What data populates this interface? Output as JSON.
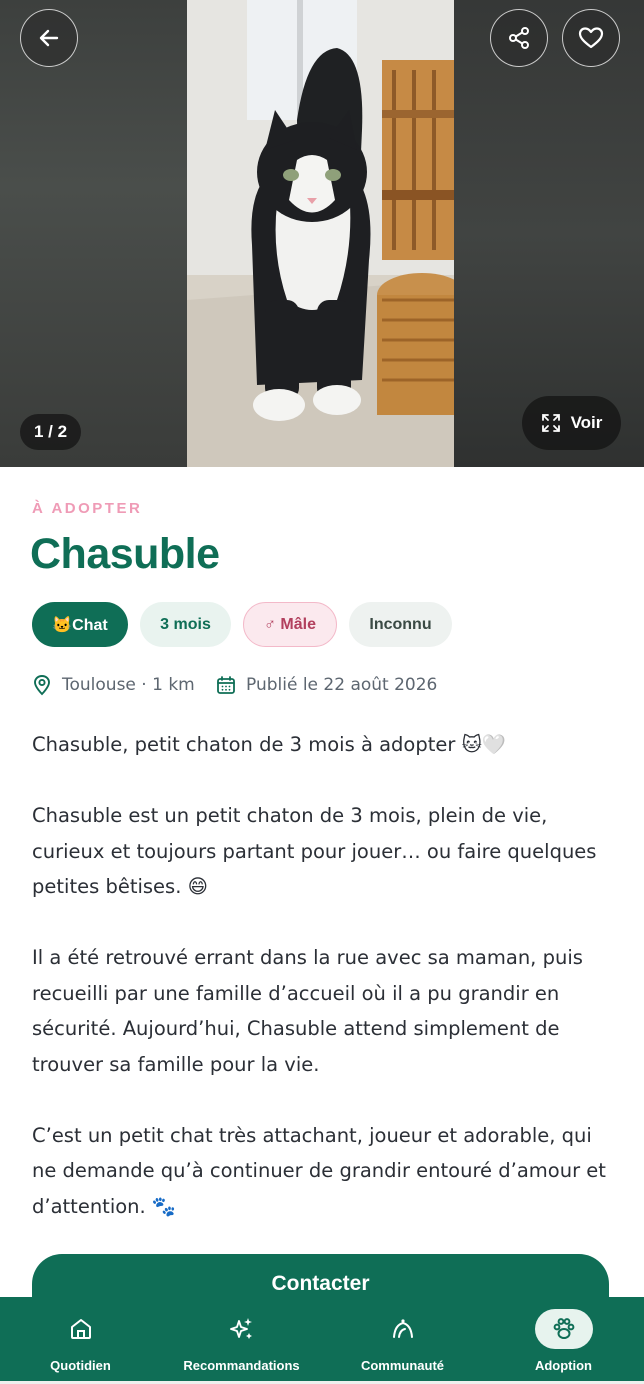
{
  "hero": {
    "counter": "1 / 2",
    "view_label": "Voir",
    "icons": {
      "back": "arrow-left-icon",
      "share": "share-icon",
      "favorite": "heart-icon",
      "expand": "expand-icon"
    }
  },
  "listing": {
    "status": "À ADOPTER",
    "name": "Chasuble",
    "chips": {
      "species": "🐱Chat",
      "age": "3 mois",
      "sex": "♂ Mâle",
      "other": "Inconnu"
    },
    "location": "Toulouse · 1 km",
    "published": "Publié le 22 août 2026",
    "description": [
      "Chasuble, petit chaton de 3 mois à adopter 🐱🤍",
      "Chasuble est un petit chaton de 3 mois, plein de vie, curieux et toujours partant pour jouer… ou faire quelques petites bêtises. 😄",
      "Il a été retrouvé errant dans la rue avec sa maman, puis recueilli par une famille d’accueil où il a pu grandir en sécurité. Aujourd’hui, Chasuble attend simplement de trouver sa famille pour la vie.",
      "C’est un petit chat très attachant, joueur et adorable, qui ne demande qu’à continuer de grandir entouré d’amour et d’attention. 🐾"
    ],
    "contact_label": "Contacter"
  },
  "nav": {
    "items": [
      {
        "label": "Quotidien",
        "icon": "home-icon"
      },
      {
        "label": "Recommandations",
        "icon": "sparkles-icon"
      },
      {
        "label": "Communauté",
        "icon": "community-icon"
      },
      {
        "label": "Adoption",
        "icon": "paw-icon",
        "active": true
      }
    ]
  },
  "colors": {
    "primary": "#0f6e56",
    "accent_pink": "#ef9bb6",
    "chip_light": "#e9f3ef"
  }
}
